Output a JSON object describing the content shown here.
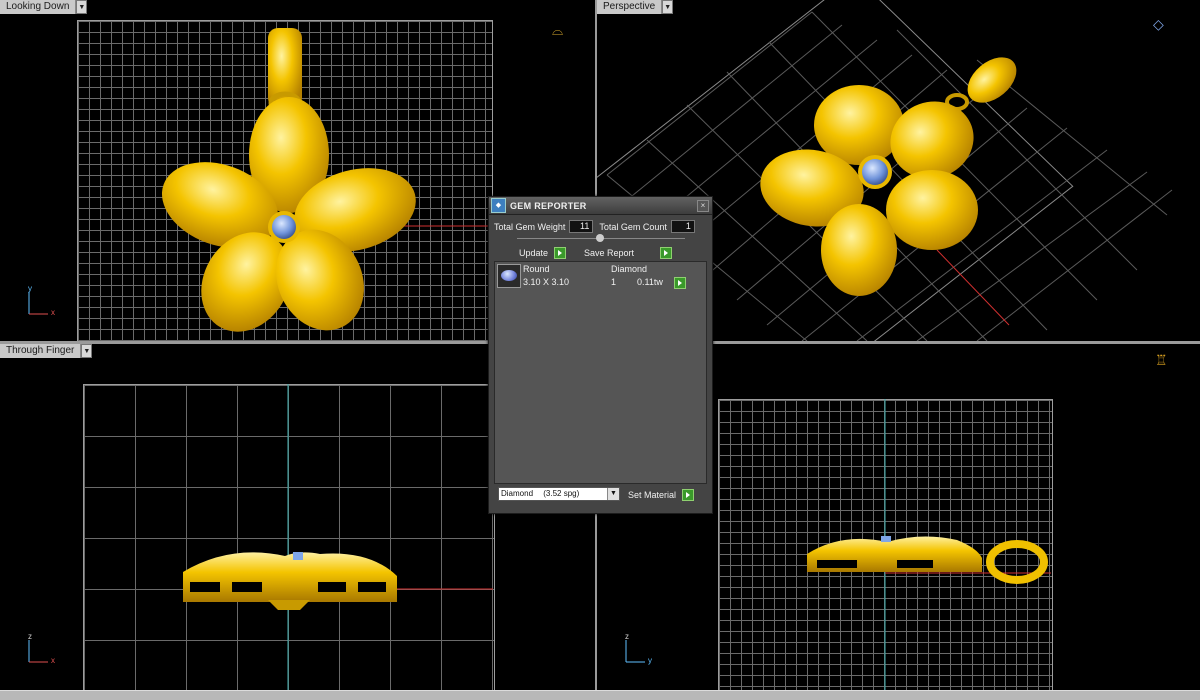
{
  "viewports": {
    "top_left": {
      "label": "Looking Down"
    },
    "top_right": {
      "label": "Perspective"
    },
    "bottom_left": {
      "label": "Through Finger"
    },
    "bottom_right": {
      "label": ""
    }
  },
  "axes": {
    "top_left": {
      "v": "y",
      "h": "x"
    },
    "bottom_left": {
      "v": "z",
      "h": "x"
    },
    "bottom_right": {
      "v": "z",
      "h": "y"
    }
  },
  "gem_reporter": {
    "title": "GEM REPORTER",
    "total_gem_weight_label": "Total Gem Weight",
    "total_gem_weight": "11",
    "total_gem_count_label": "Total Gem Count",
    "total_gem_count": "1",
    "update_label": "Update",
    "save_report_label": "Save Report",
    "table": {
      "headers": [
        "Round",
        "Diamond"
      ],
      "row": {
        "size": "3.10 X 3.10",
        "count": "1",
        "weight": "0.11tw"
      }
    },
    "material": {
      "name": "Diamond",
      "spg": "(3.52 spg)"
    },
    "set_material_label": "Set Material"
  },
  "colors": {
    "gold": "#f2c200",
    "gem": "#7fa6e8",
    "grid": "#6a6a6a",
    "panel": "#444444"
  }
}
